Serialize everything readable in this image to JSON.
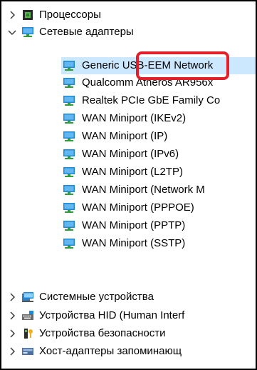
{
  "tree": {
    "top_categories": [
      {
        "label": "Процессоры",
        "icon": "processor-icon",
        "expanded": false
      }
    ],
    "network_category": {
      "label": "Сетевые адаптеры",
      "icon": "network-adapter-icon",
      "expanded": true,
      "children": [
        {
          "label": "Generic USB-EEM Network",
          "icon": "network-adapter-icon",
          "selected": true
        },
        {
          "label": "Qualcomm Atheros AR956x",
          "icon": "network-adapter-icon"
        },
        {
          "label": "Realtek PCIe GbE Family Co",
          "icon": "network-adapter-icon"
        },
        {
          "label": "WAN Miniport (IKEv2)",
          "icon": "network-adapter-icon"
        },
        {
          "label": "WAN Miniport (IP)",
          "icon": "network-adapter-icon"
        },
        {
          "label": "WAN Miniport (IPv6)",
          "icon": "network-adapter-icon"
        },
        {
          "label": "WAN Miniport (L2TP)",
          "icon": "network-adapter-icon"
        },
        {
          "label": "WAN Miniport (Network M",
          "icon": "network-adapter-icon"
        },
        {
          "label": "WAN Miniport (PPPOE)",
          "icon": "network-adapter-icon"
        },
        {
          "label": "WAN Miniport (PPTP)",
          "icon": "network-adapter-icon"
        },
        {
          "label": "WAN Miniport (SSTP)",
          "icon": "network-adapter-icon"
        }
      ]
    },
    "bottom_categories": [
      {
        "label": "Системные устройства",
        "icon": "system-devices-icon"
      },
      {
        "label": "Устройства HID (Human Interf",
        "icon": "hid-keyboard-icon"
      },
      {
        "label": "Устройства безопасности",
        "icon": "security-key-icon"
      },
      {
        "label": "Хост-адаптеры запоминающ",
        "icon": "storage-controller-icon"
      }
    ]
  },
  "colors": {
    "selection": "#cce8ff",
    "annotation_box": "#e3202a",
    "chevron": "#333333",
    "monitor_blue": "#1e88d8",
    "cable_green": "#2e9d3a"
  }
}
